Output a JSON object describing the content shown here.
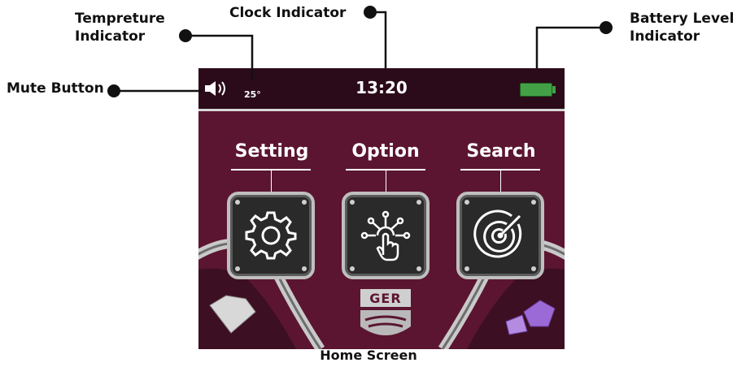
{
  "callouts": {
    "temperature": "Tempreture\nIndicator",
    "clock": "Clock Indicator",
    "battery": "Battery Level\nIndicator",
    "mute": "Mute Button"
  },
  "status_bar": {
    "time": "13:20",
    "temperature": "25°",
    "speaker_icon": "speaker-icon",
    "battery_icon": "battery-icon",
    "battery_color": "#43a047"
  },
  "menu": {
    "items": [
      {
        "label": "Setting",
        "icon": "gear-icon"
      },
      {
        "label": "Option",
        "icon": "touch-network-icon"
      },
      {
        "label": "Search",
        "icon": "radar-icon"
      }
    ]
  },
  "brand": {
    "logo_text": "GER"
  },
  "caption": "Home Screen",
  "colors": {
    "screen_background": "#5b1530",
    "status_bar_background": "#2b0b19",
    "tile_frame": "#bfbfbf"
  }
}
